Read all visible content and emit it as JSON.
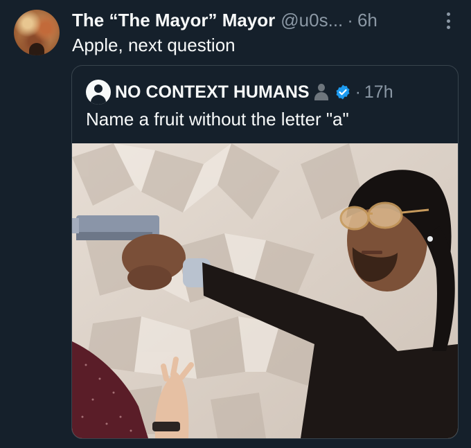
{
  "tweet": {
    "display_name": "The “The Mayor” Mayor",
    "handle": "@u0s...",
    "separator": "·",
    "time": "6h",
    "text": "Apple, next question"
  },
  "quoted": {
    "display_name": "NO CONTEXT HUMANS",
    "separator": "·",
    "time": "17h",
    "text": "Name a fruit without the letter \"a\"",
    "emoji_icon": "bust-in-silhouette-icon",
    "verified_icon": "verified-badge-icon",
    "verified_color": "#1d9bf0"
  },
  "colors": {
    "background": "#15202b",
    "secondary_text": "#8b98a5",
    "border": "#38444d"
  }
}
